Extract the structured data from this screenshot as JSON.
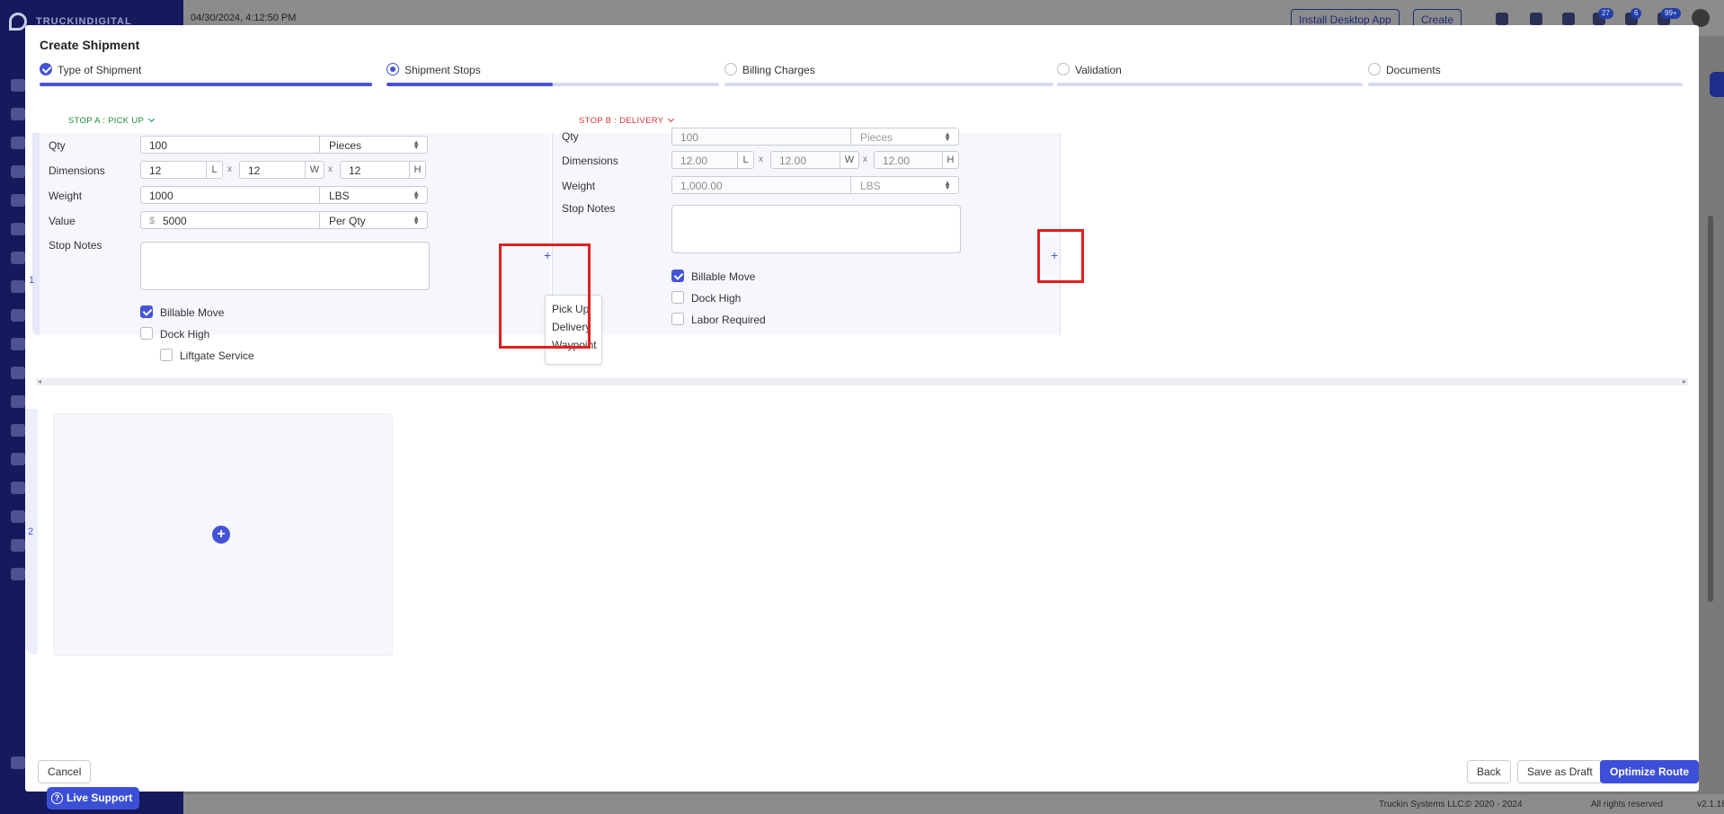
{
  "background": {
    "brand": "TRUCKINDIGITAL",
    "datetime": "04/30/2024, 4:12:50 PM",
    "install_button": "Install Desktop App",
    "create_button": "Create",
    "badges": [
      "27",
      "6",
      "99+"
    ],
    "footer_company": "Truckin Systems LLC.",
    "footer_copyright": "© 2020 - 2024",
    "footer_rights": "All rights reserved",
    "footer_version": "v2.1.18",
    "live_support": "Live Support"
  },
  "modal": {
    "title": "Create Shipment",
    "steps": [
      {
        "label": "Type of Shipment",
        "state": "done",
        "progress": 1.0
      },
      {
        "label": "Shipment Stops",
        "state": "active",
        "progress": 0.5
      },
      {
        "label": "Billing Charges",
        "state": "pending",
        "progress": 0
      },
      {
        "label": "Validation",
        "state": "pending",
        "progress": 0
      },
      {
        "label": "Documents",
        "state": "pending",
        "progress": 0
      }
    ],
    "stop_a": {
      "header": "STOP A : PICK UP",
      "qty_label": "Qty",
      "qty_value": "100",
      "qty_unit": "Pieces",
      "dimensions_label": "Dimensions",
      "length": "12",
      "length_unit": "L",
      "width": "12",
      "width_unit": "W",
      "height": "12",
      "height_unit": "H",
      "times": "x",
      "weight_label": "Weight",
      "weight_value": "1000",
      "weight_unit": "LBS",
      "value_label": "Value",
      "currency": "$",
      "value_value": "5000",
      "value_unit": "Per Qty",
      "notes_label": "Stop Notes",
      "checkboxes": [
        {
          "label": "Billable Move",
          "checked": true
        },
        {
          "label": "Dock High",
          "checked": false
        },
        {
          "label": "Liftgate Service",
          "checked": false
        }
      ]
    },
    "stop_b": {
      "header": "STOP B : DELIVERY",
      "qty_label": "Qty",
      "qty_value": "100",
      "qty_unit": "Pieces",
      "dimensions_label": "Dimensions",
      "length": "12.00",
      "length_unit": "L",
      "width": "12.00",
      "width_unit": "W",
      "height": "12.00",
      "height_unit": "H",
      "times": "x",
      "weight_label": "Weight",
      "weight_value": "1,000.00",
      "weight_unit": "LBS",
      "notes_label": "Stop Notes",
      "checkboxes": [
        {
          "label": "Billable Move",
          "checked": true
        },
        {
          "label": "Dock High",
          "checked": false
        },
        {
          "label": "Labor Required",
          "checked": false
        }
      ]
    },
    "add_stop_menu": [
      "Pick Up",
      "Delivery",
      "Waypoint"
    ],
    "group_numbers": [
      "1",
      "2"
    ],
    "buttons": {
      "cancel": "Cancel",
      "back": "Back",
      "save_draft": "Save as Draft",
      "optimize": "Optimize Route"
    }
  },
  "icons": {
    "plus": "+",
    "caret": "⬍"
  },
  "colors": {
    "accent": "#4553d9",
    "stop_a": "#1f8a3a",
    "stop_b": "#d4373a",
    "highlight": "#e02020"
  }
}
